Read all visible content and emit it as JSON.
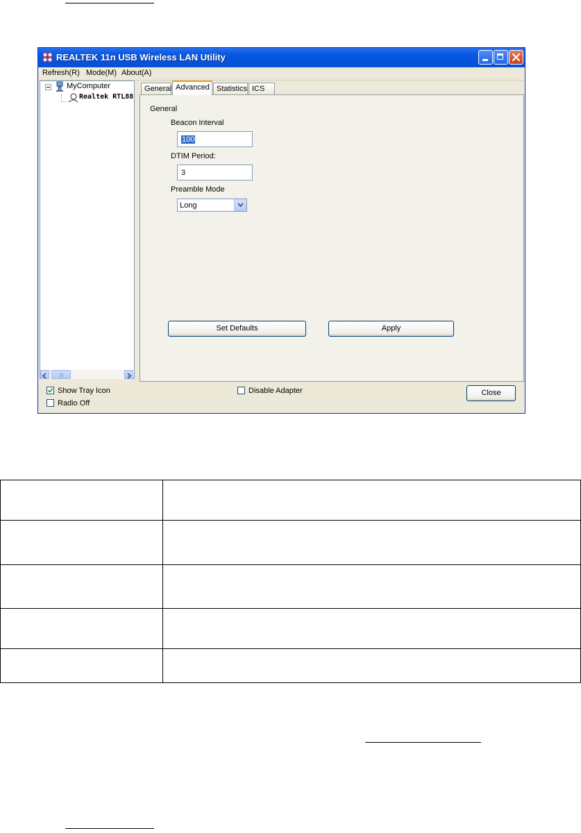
{
  "window": {
    "title": "REALTEK 11n USB Wireless LAN Utility",
    "menu": [
      "Refresh(R)",
      "Mode(M)",
      "About(A)"
    ]
  },
  "tree": {
    "root": "MyComputer",
    "child": "Realtek RTL88"
  },
  "tabs": [
    "General",
    "Advanced",
    "Statistics",
    "ICS"
  ],
  "active_tab": "Advanced",
  "panel": {
    "group_title": "General",
    "beacon_label": "Beacon Interval",
    "beacon_value": "100",
    "dtim_label": "DTIM Period:",
    "dtim_value": "3",
    "preamble_label": "Preamble Mode",
    "preamble_value": "Long",
    "set_defaults": "Set Defaults",
    "apply": "Apply"
  },
  "footer": {
    "show_tray_icon": "Show Tray Icon",
    "show_tray_checked": true,
    "radio_off": "Radio Off",
    "radio_off_checked": false,
    "disable_adapter": "Disable Adapter",
    "disable_adapter_checked": false,
    "close": "Close"
  },
  "colors": {
    "titlebar": "#0a5ae6",
    "window_bg": "#ece9d8",
    "active_tab_accent": "#f0a01a",
    "selection": "#316ac5"
  }
}
